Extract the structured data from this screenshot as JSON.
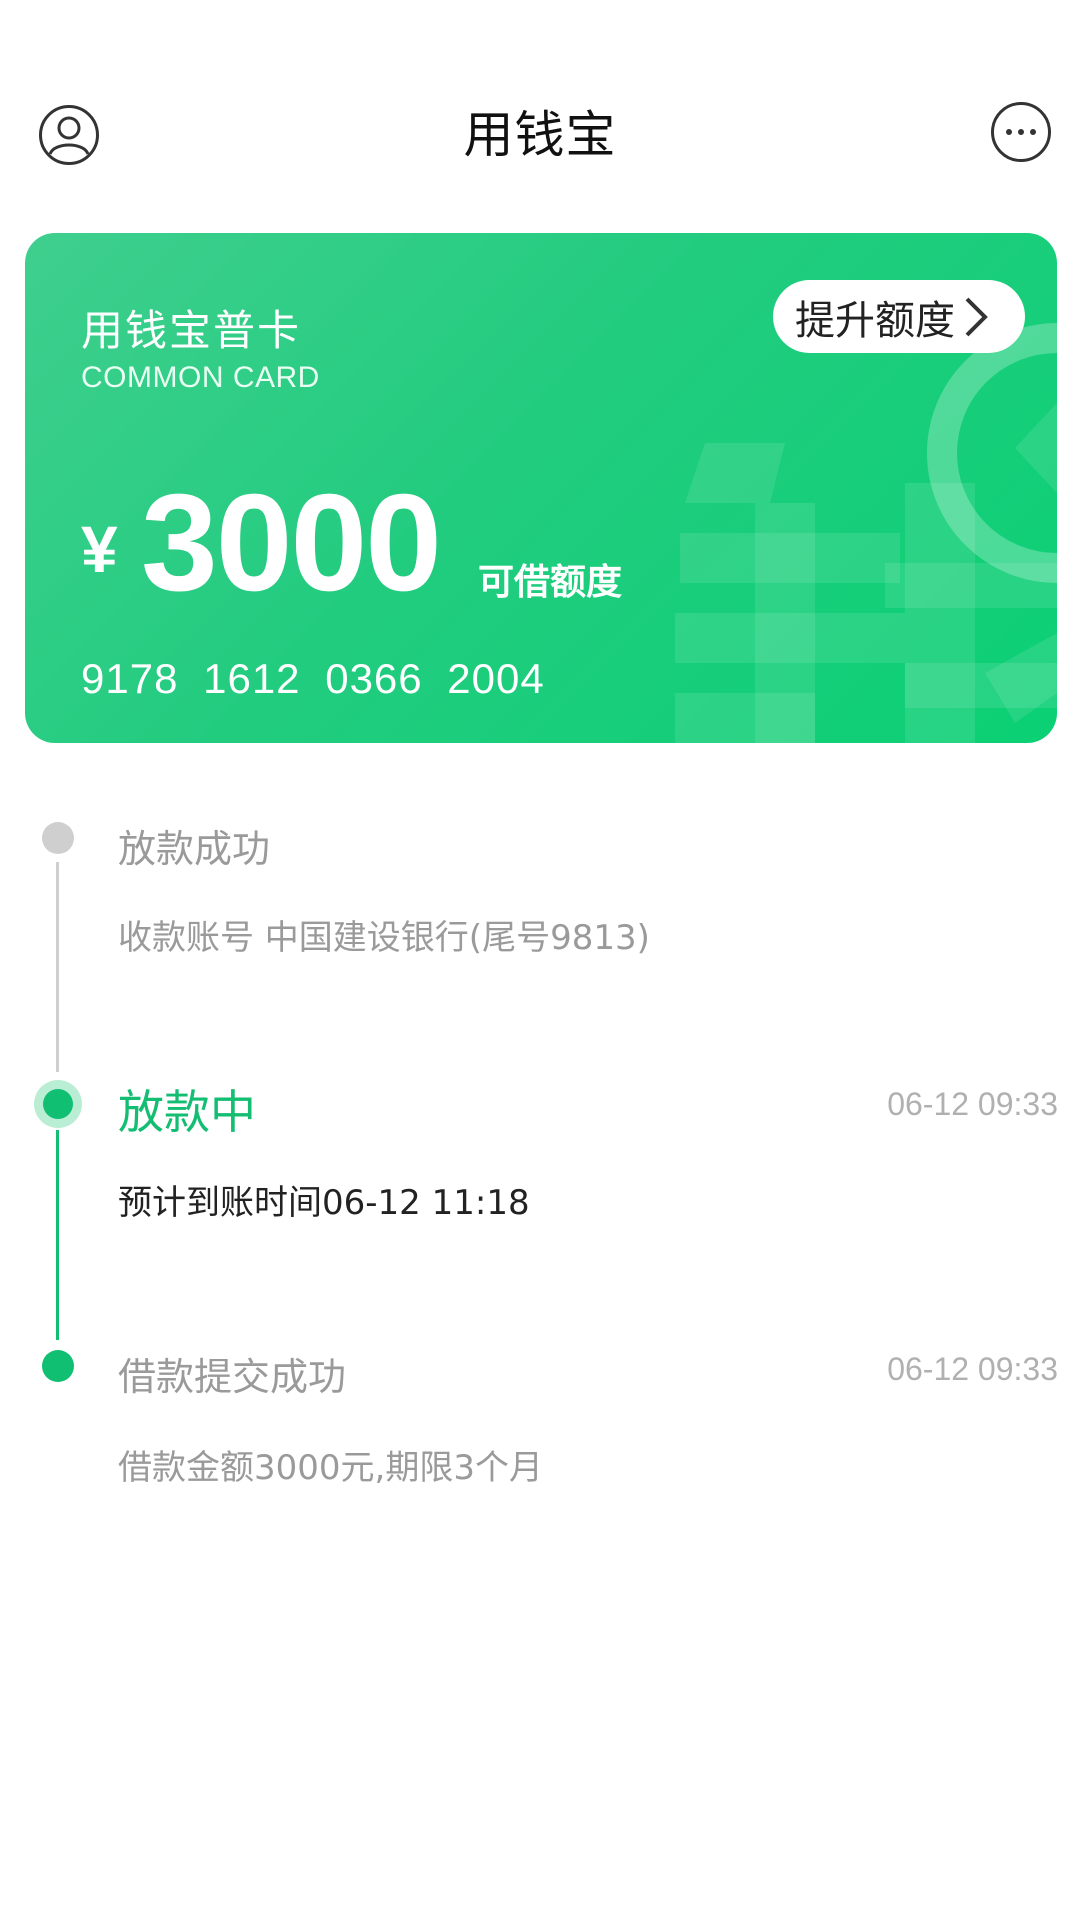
{
  "header": {
    "title": "用钱宝",
    "profile_icon": "user-circle-icon",
    "more_icon": "more-dots-icon"
  },
  "card": {
    "title": "用钱宝普卡",
    "subtitle": "COMMON CARD",
    "raise_button": "提升额度",
    "currency": "¥",
    "amount": "3000",
    "amount_label": "可借额度",
    "card_number": "9178 1612 0366 2004",
    "watermark_icon": "coin-watermark-icon",
    "colors": {
      "gradient_start": "#3fcf8e",
      "gradient_end": "#0bd074"
    }
  },
  "timeline": {
    "steps": [
      {
        "title": "放款成功",
        "time": "",
        "description": "收款账号 中国建设银行(尾号9813)",
        "status": "pending"
      },
      {
        "title": "放款中",
        "time": "06-12 09:33",
        "description": "预计到账时间06-12 11:18",
        "status": "active"
      },
      {
        "title": "借款提交成功",
        "time": "06-12 09:33",
        "description": "借款金额3000元,期限3个月",
        "status": "done"
      }
    ],
    "colors": {
      "active": "#13bd72",
      "inactive": "#cfcfcf"
    }
  }
}
